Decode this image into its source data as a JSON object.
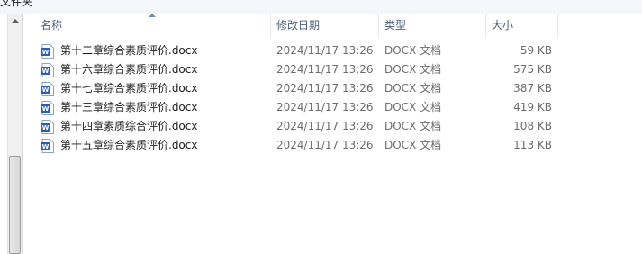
{
  "window": {
    "clipped_title": "文件夹"
  },
  "columns": {
    "name": "名称",
    "modified": "修改日期",
    "type": "类型",
    "size": "大小"
  },
  "files": [
    {
      "name": "第十二章综合素质评价.docx",
      "modified": "2024/11/17 13:26",
      "type": "DOCX 文档",
      "size": "59 KB",
      "icon": "word-doc-icon"
    },
    {
      "name": "第十六章综合素质评价.docx",
      "modified": "2024/11/17 13:26",
      "type": "DOCX 文档",
      "size": "575 KB",
      "icon": "word-doc-icon"
    },
    {
      "name": "第十七章综合素质评价.docx",
      "modified": "2024/11/17 13:26",
      "type": "DOCX 文档",
      "size": "387 KB",
      "icon": "word-doc-icon"
    },
    {
      "name": "第十三章综合素质评价.docx",
      "modified": "2024/11/17 13:26",
      "type": "DOCX 文档",
      "size": "419 KB",
      "icon": "word-doc-icon"
    },
    {
      "name": "第十四章素质综合评价.docx",
      "modified": "2024/11/17 13:26",
      "type": "DOCX 文档",
      "size": "108 KB",
      "icon": "word-doc-icon"
    },
    {
      "name": "第十五章综合素质评价.docx",
      "modified": "2024/11/17 13:26",
      "type": "DOCX 文档",
      "size": "113 KB",
      "icon": "word-doc-icon"
    }
  ],
  "colors": {
    "header_text": "#4c607a",
    "detail_text": "#6d6d6d",
    "word_icon_blue": "#2b5fb4"
  }
}
